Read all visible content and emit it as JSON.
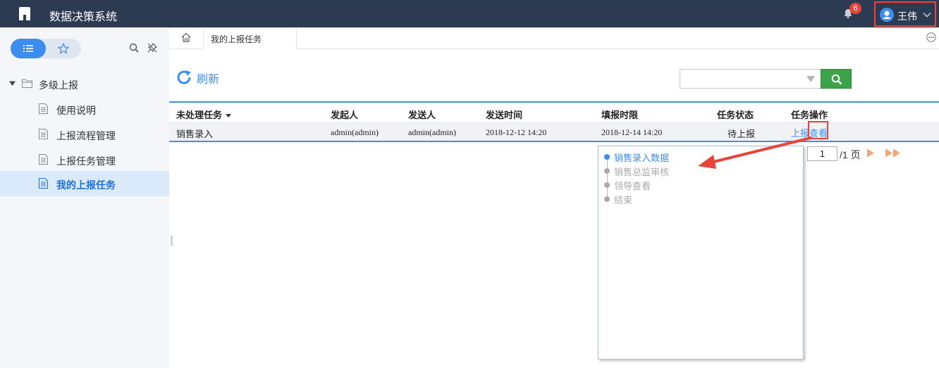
{
  "app": {
    "title": "数据决策系统"
  },
  "header": {
    "notification_count": "6",
    "user_name": "王伟"
  },
  "sidebar": {
    "root": {
      "label": "多级上报"
    },
    "items": [
      {
        "label": "使用说明"
      },
      {
        "label": "上报流程管理"
      },
      {
        "label": "上报任务管理"
      },
      {
        "label": "我的上报任务"
      }
    ]
  },
  "tabs": {
    "active_label": "我的上报任务"
  },
  "toolbar": {
    "refresh_label": "刷新",
    "combo_value": ""
  },
  "table": {
    "headers": [
      "未处理任务",
      "发起人",
      "发送人",
      "发送时间",
      "填报时限",
      "任务状态",
      "任务操作"
    ],
    "rows": [
      {
        "task": "销售录入",
        "initiator": "admin(admin)",
        "sender": "admin(admin)",
        "send_time": "2018-12-12 14:20",
        "deadline": "2018-12-14 14:20",
        "status": "待上报",
        "action_report": "上报",
        "action_view": "查看"
      }
    ]
  },
  "pagination": {
    "current_page": "1",
    "total_label": "/1 页"
  },
  "flow": {
    "steps": [
      {
        "label": "销售录入数据",
        "current": true
      },
      {
        "label": "销售总监审核",
        "current": false
      },
      {
        "label": "领导查看",
        "current": false
      },
      {
        "label": "结束",
        "current": false
      }
    ]
  },
  "colors": {
    "topbar": "#2c3a52",
    "accent": "#3c8df0",
    "highlight": "#e8443a",
    "search_button": "#3ba349"
  }
}
